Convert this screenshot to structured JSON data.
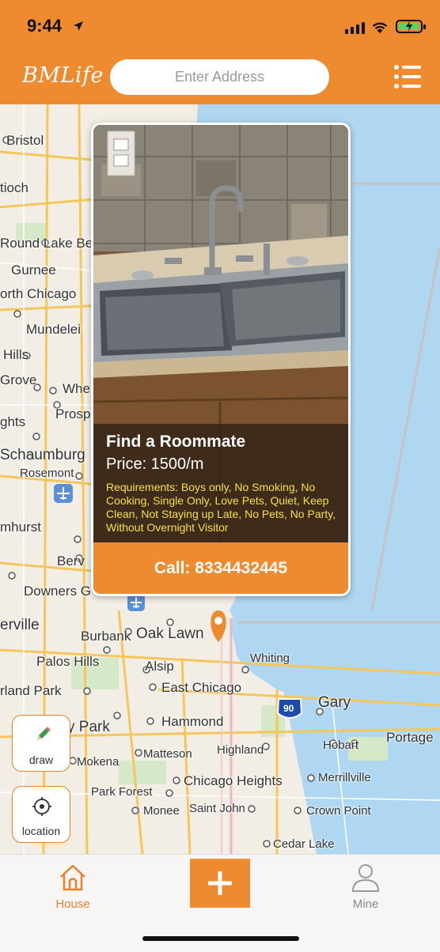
{
  "status_bar": {
    "time": "9:44"
  },
  "header": {
    "logo": "BMLife",
    "search_placeholder": "Enter Address"
  },
  "map": {
    "labels": [
      "Bristol",
      "tioch",
      "Round Lake Be",
      "Gurnee",
      "orth Chicago",
      "Mundelei",
      "Hills",
      "Grove",
      "Whe",
      "Prosp",
      "ghts",
      "Schaumburg",
      "Rosemont",
      "mhurst",
      "Berv",
      "Downers G",
      "erville",
      "Burbank",
      "Oak Lawn",
      "Palos Hills",
      "Alsip",
      "Whiting",
      "rland Park",
      "East Chicago",
      "Gary",
      "y Park",
      "Hammond",
      "Portage",
      "Matteson",
      "Highland",
      "Hobart",
      "Mokena",
      "Chicago Heights",
      "Merrillville",
      "Park Forest",
      "Monee",
      "Saint John",
      "Crown Point",
      "Cedar Lake",
      "90"
    ]
  },
  "listing": {
    "title": "Find a Roommate",
    "price": "Price: 1500/m",
    "requirements": "Requirements: Boys only, No Smoking, No Cooking, Single Only, Love Pets, Quiet, Keep Clean, Not Staying up Late, No Pets, No Party, Without Overnight Visitor",
    "call": "Call: 8334432445"
  },
  "fabs": {
    "draw": "draw",
    "location": "location"
  },
  "tabbar": {
    "house": "House",
    "mine": "Mine"
  },
  "colors": {
    "accent": "#EE8A30",
    "requirements_text": "#F5E04A",
    "water": "#AFD7F2"
  },
  "icons": [
    "location-arrow-icon",
    "signal-icon",
    "wifi-icon",
    "battery-icon",
    "menu-list-icon",
    "pencil-icon",
    "crosshair-icon",
    "house-icon",
    "plus-icon",
    "person-icon",
    "map-pin-icon",
    "airport-icon"
  ]
}
